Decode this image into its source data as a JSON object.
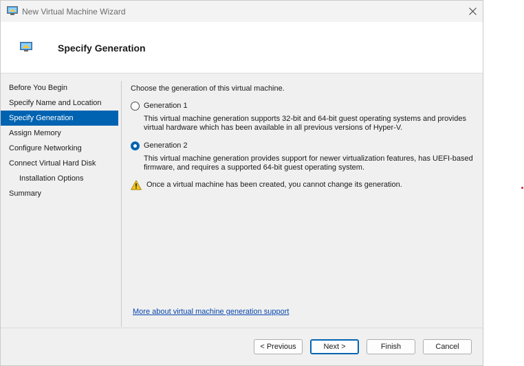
{
  "window": {
    "title": "New Virtual Machine Wizard"
  },
  "header": {
    "title": "Specify Generation"
  },
  "nav": {
    "items": [
      {
        "label": "Before You Begin"
      },
      {
        "label": "Specify Name and Location"
      },
      {
        "label": "Specify Generation"
      },
      {
        "label": "Assign Memory"
      },
      {
        "label": "Configure Networking"
      },
      {
        "label": "Connect Virtual Hard Disk"
      },
      {
        "label": "Installation Options"
      },
      {
        "label": "Summary"
      }
    ],
    "selected": "Specify Generation"
  },
  "content": {
    "intro": "Choose the generation of this virtual machine.",
    "gen1": {
      "label": "Generation 1",
      "description": "This virtual machine generation supports 32-bit and 64-bit guest operating systems and provides virtual hardware which has been available in all previous versions of Hyper-V.",
      "selected": false
    },
    "gen2": {
      "label": "Generation 2",
      "description": "This virtual machine generation provides support for newer virtualization features, has UEFI-based firmware, and requires a supported 64-bit guest operating system.",
      "selected": true
    },
    "warning": "Once a virtual machine has been created, you cannot change its generation.",
    "more_link": "More about virtual machine generation support"
  },
  "buttons": {
    "previous": "< Previous",
    "next": "Next >",
    "finish": "Finish",
    "cancel": "Cancel"
  },
  "colors": {
    "accent": "#0063b1",
    "link": "#0645ad",
    "warning": "#f0c419"
  }
}
